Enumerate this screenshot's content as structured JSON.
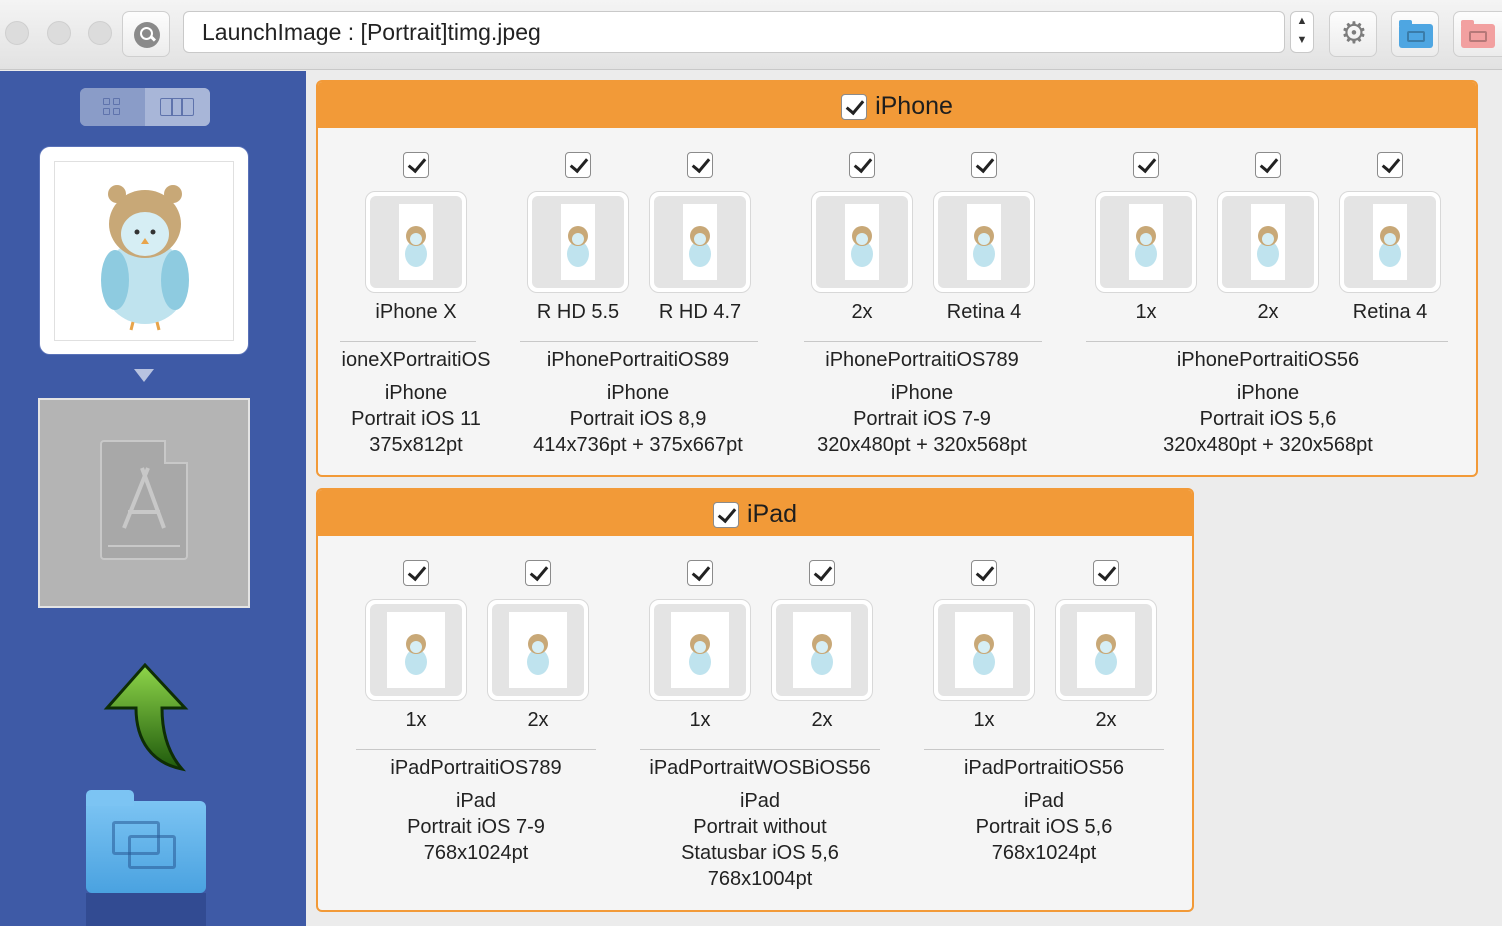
{
  "titlebar": {
    "path_value": "LaunchImage :  [Portrait]timg.jpeg",
    "icons": [
      "search-icon",
      "gear-icon",
      "blue-folder-icon",
      "red-folder-icon"
    ]
  },
  "sidebar": {
    "view_modes": [
      "grid-view",
      "column-view"
    ]
  },
  "iphone": {
    "title": "iPhone",
    "cells": [
      {
        "label": "iPhone X"
      },
      {
        "label": "R HD 5.5"
      },
      {
        "label": "R HD 4.7"
      },
      {
        "label": "2x"
      },
      {
        "label": "Retina 4"
      },
      {
        "label": "1x"
      },
      {
        "label": "2x"
      },
      {
        "label": "Retina 4"
      }
    ],
    "groups": [
      {
        "name": "ioneXPortraitiOS",
        "device": "iPhone",
        "desc1": "Portrait iOS 11",
        "size": "375x812pt"
      },
      {
        "name": "iPhonePortraitiOS89",
        "device": "iPhone",
        "desc1": "Portrait iOS 8,9",
        "size": "414x736pt + 375x667pt"
      },
      {
        "name": "iPhonePortraitiOS789",
        "device": "iPhone",
        "desc1": "Portrait iOS 7-9",
        "size": "320x480pt + 320x568pt"
      },
      {
        "name": "iPhonePortraitiOS56",
        "device": "iPhone",
        "desc1": "Portrait iOS 5,6",
        "size": "320x480pt + 320x568pt"
      }
    ]
  },
  "ipad": {
    "title": "iPad",
    "cells": [
      {
        "label": "1x"
      },
      {
        "label": "2x"
      },
      {
        "label": "1x"
      },
      {
        "label": "2x"
      },
      {
        "label": "1x"
      },
      {
        "label": "2x"
      }
    ],
    "groups": [
      {
        "name": "iPadPortraitiOS789",
        "device": "iPad",
        "desc1": "Portrait iOS 7-9",
        "desc2": "",
        "size": "768x1024pt"
      },
      {
        "name": "iPadPortraitWOSBiOS56",
        "device": "iPad",
        "desc1": "Portrait without",
        "desc2": "Statusbar iOS 5,6",
        "size": "768x1004pt"
      },
      {
        "name": "iPadPortraitiOS56",
        "device": "iPad",
        "desc1": "Portrait iOS 5,6",
        "desc2": "",
        "size": "768x1024pt"
      }
    ]
  },
  "colors": {
    "sidebar": "#3e5aa6",
    "panel_accent": "#f29a38",
    "window": "#ececec"
  }
}
